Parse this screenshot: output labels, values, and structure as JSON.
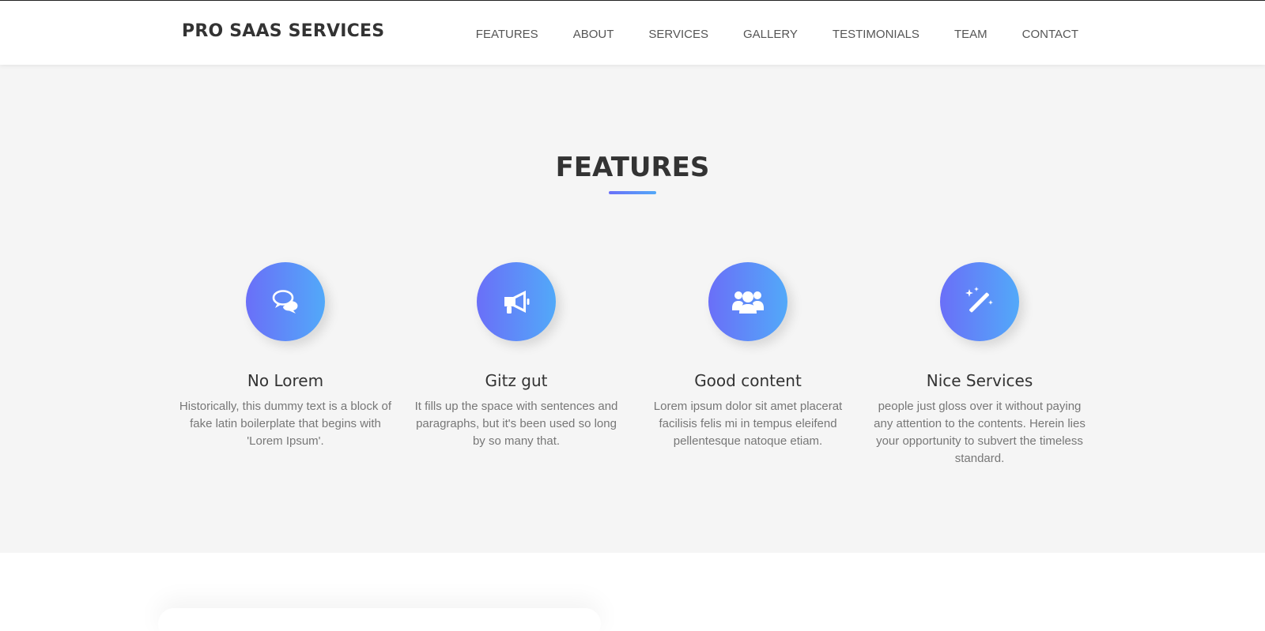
{
  "navbar": {
    "brand": "PRO SAAS SERVICES",
    "links": [
      "FEATURES",
      "ABOUT",
      "SERVICES",
      "GALLERY",
      "TESTIMONIALS",
      "TEAM",
      "CONTACT"
    ]
  },
  "features": {
    "title": "FEATURES",
    "items": [
      {
        "icon": "chat-bubbles-icon",
        "title": "No Lorem",
        "desc": "Historically, this dummy text is a block of fake latin boilerplate that begins with 'Lorem Ipsum'."
      },
      {
        "icon": "megaphone-icon",
        "title": "Gitz gut",
        "desc": "It fills up the space with sentences and paragraphs, but it's been used so long by so many that."
      },
      {
        "icon": "users-icon",
        "title": "Good content",
        "desc": "Lorem ipsum dolor sit amet placerat facilisis felis mi in tempus eleifend pellentesque natoque etiam."
      },
      {
        "icon": "magic-wand-icon",
        "title": "Nice Services",
        "desc": "people just gloss over it without paying any attention to the contents. Herein lies your opportunity to subvert the timeless standard."
      }
    ]
  },
  "colors": {
    "gradient_start": "#6a6ff8",
    "gradient_end": "#52a9f9",
    "section_bg": "#f5f5f5",
    "text_dark": "#333333",
    "text_muted": "#777777"
  }
}
